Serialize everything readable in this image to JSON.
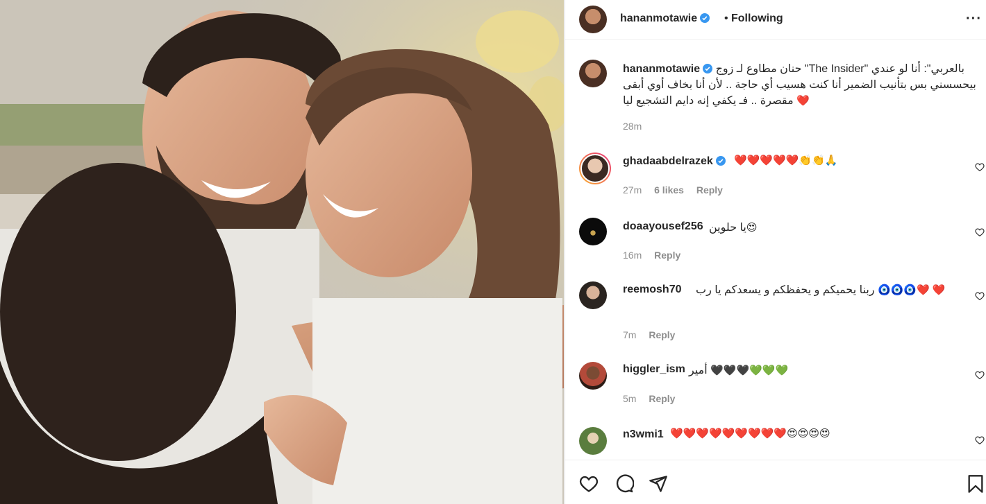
{
  "post": {
    "author": "hananmotawie",
    "follow_status": "Following",
    "caption_text": "بالعربي\": أنا لو عندي \"The Insider\" حنان مطاوع لـ زوج بيحسسني بس بتأنيب الضمير أنا كنت هسيب أي حاجة .. لأن أنا بخاف أوي أبقى مقصرة .. فـ يكفي إنه دايم التشجيع ليا",
    "caption_emoji": "❤️",
    "caption_time": "28m"
  },
  "comments": [
    {
      "user": "ghadaabdelrazek",
      "verified": true,
      "text": "",
      "emojis": "❤️❤️❤️❤️❤️👏👏🙏",
      "time": "27m",
      "likes": "6 likes",
      "reply": "Reply"
    },
    {
      "user": "doaayousef256",
      "verified": false,
      "text": "يا حلوين",
      "emojis": "😍",
      "time": "16m",
      "likes": "",
      "reply": "Reply"
    },
    {
      "user": "reemosh70",
      "verified": false,
      "text": "ربنا يحميكم و يحفظكم و يسعدكم يا رب",
      "emojis": "🧿🧿🧿❤️ ❤️",
      "time": "7m",
      "likes": "",
      "reply": "Reply"
    },
    {
      "user": "higgler_ism",
      "verified": false,
      "text": "أمير",
      "emojis": "🖤🖤🖤💚💚💚",
      "time": "5m",
      "likes": "",
      "reply": "Reply"
    },
    {
      "user": "n3wmi1",
      "verified": false,
      "text": "",
      "emojis": "❤️❤️❤️❤️❤️❤️❤️❤️❤️😍😍😍😍",
      "time": "",
      "likes": "",
      "reply": ""
    }
  ],
  "icons": {
    "like": "heart-icon",
    "comment": "comment-icon",
    "share": "paper-plane-icon",
    "save": "bookmark-icon",
    "more": "more-options-icon",
    "verified": "verified-badge-icon"
  },
  "colors": {
    "verified": "#3897f0",
    "heart": "#ed4956",
    "muted": "#8e8e8e"
  }
}
